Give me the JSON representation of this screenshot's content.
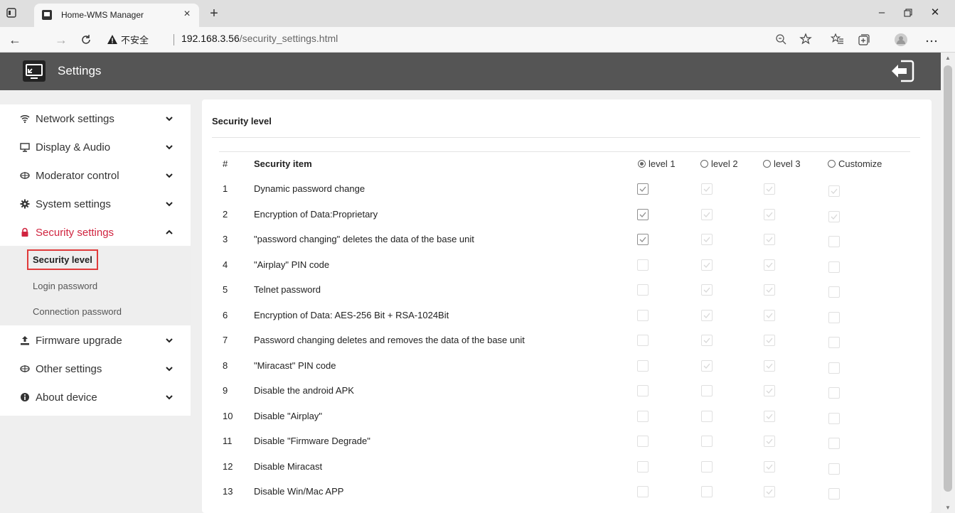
{
  "browser": {
    "tab_title": "Home-WMS Manager",
    "tab_close": "×",
    "new_tab": "+",
    "insecure_label": "不安全",
    "url_host": "192.168.3.56",
    "url_path": "/security_settings.html"
  },
  "app": {
    "title": "Settings"
  },
  "sidebar": {
    "items": [
      {
        "label": "Network settings",
        "icon": "wifi-icon"
      },
      {
        "label": "Display & Audio",
        "icon": "monitor-icon"
      },
      {
        "label": "Moderator control",
        "icon": "moderator-icon"
      },
      {
        "label": "System settings",
        "icon": "gear-icon"
      },
      {
        "label": "Security settings",
        "icon": "lock-icon",
        "active": true
      },
      {
        "label": "Firmware upgrade",
        "icon": "upload-icon"
      },
      {
        "label": "Other settings",
        "icon": "other-icon"
      },
      {
        "label": "About device",
        "icon": "info-icon"
      }
    ],
    "security_sub": [
      "Security level",
      "Login password",
      "Connection password"
    ]
  },
  "colors": {
    "header_bg": "#555555",
    "accent_red": "#d0243f"
  },
  "security": {
    "title": "Security level",
    "col_num": "#",
    "col_item": "Security item",
    "levels": [
      "level 1",
      "level 2",
      "level 3",
      "Customize"
    ],
    "selected_level": "level 1",
    "rows": [
      {
        "n": "1",
        "item": "Dynamic password change",
        "checks": [
          1,
          1,
          1,
          1
        ]
      },
      {
        "n": "2",
        "item": "Encryption of Data:Proprietary",
        "checks": [
          1,
          1,
          1,
          1
        ]
      },
      {
        "n": "3",
        "item": "\"password changing\" deletes the data of the base unit",
        "checks": [
          1,
          1,
          1,
          0
        ]
      },
      {
        "n": "4",
        "item": "\"Airplay\" PIN code",
        "checks": [
          0,
          1,
          1,
          0
        ]
      },
      {
        "n": "5",
        "item": "Telnet password",
        "checks": [
          0,
          1,
          1,
          0
        ]
      },
      {
        "n": "6",
        "item": "Encryption of Data: AES-256 Bit + RSA-1024Bit",
        "checks": [
          0,
          1,
          1,
          0
        ]
      },
      {
        "n": "7",
        "item": "Password changing deletes and removes the data of the base unit",
        "checks": [
          0,
          1,
          1,
          0
        ]
      },
      {
        "n": "8",
        "item": "\"Miracast\" PIN code",
        "checks": [
          0,
          1,
          1,
          0
        ]
      },
      {
        "n": "9",
        "item": "Disable the android APK",
        "checks": [
          0,
          0,
          1,
          0
        ]
      },
      {
        "n": "10",
        "item": "Disable \"Airplay\"",
        "checks": [
          0,
          0,
          1,
          0
        ]
      },
      {
        "n": "11",
        "item": "Disable \"Firmware Degrade\"",
        "checks": [
          0,
          0,
          1,
          0
        ]
      },
      {
        "n": "12",
        "item": "Disable Miracast",
        "checks": [
          0,
          0,
          1,
          0
        ]
      },
      {
        "n": "13",
        "item": "Disable Win/Mac APP",
        "checks": [
          0,
          0,
          1,
          0
        ]
      }
    ]
  }
}
